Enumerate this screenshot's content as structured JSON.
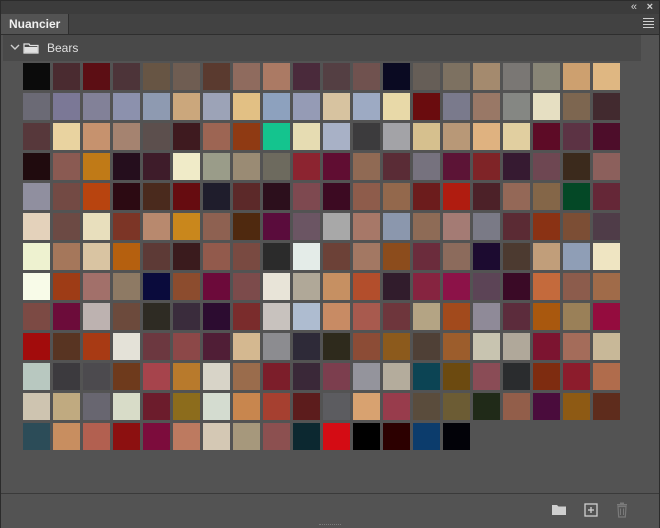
{
  "panel": {
    "tab_label": "Nuancier",
    "collapse_glyph": "«",
    "close_glyph": "×"
  },
  "group": {
    "name": "Bears",
    "icons": {
      "chevron": "chevron-down-icon",
      "folder": "folder-icon"
    }
  },
  "footer": {
    "icons": [
      "new-group-folder-icon",
      "new-swatch-icon",
      "trash-icon"
    ]
  },
  "swatches": [
    "#0b0b0b",
    "#4a2b30",
    "#5c0e14",
    "#4d3439",
    "#675544",
    "#6f5d52",
    "#5a3a2f",
    "#8f6b5e",
    "#ab7a64",
    "#4a2a3b",
    "#543f43",
    "#70524f",
    "#0a0a22",
    "#665e57",
    "#7d7161",
    "#a48a6e",
    "#7a7774",
    "#888576",
    "#cda06f",
    "#dfb782",
    "#6b6a75",
    "#7b7896",
    "#828198",
    "#8c91ad",
    "#8e9ab1",
    "#cba77c",
    "#9ca3b7",
    "#e2c084",
    "#8da1be",
    "#959bb5",
    "#d7c3a0",
    "#9daac3",
    "#e8d9a8",
    "#6a0c0e",
    "#7a7a8c",
    "#997866",
    "#858783",
    "#e6dfc2",
    "#7d6650",
    "#422a2f",
    "#57383b",
    "#e9d3a0",
    "#c6926e",
    "#a58370",
    "#5c4f4d",
    "#3e1a1f",
    "#9d6553",
    "#8f3a13",
    "#14c48e",
    "#e6dcb2",
    "#a8b1c6",
    "#3c3b3d",
    "#a3a3a7",
    "#d6c08e",
    "#b89877",
    "#dfb280",
    "#e1cfa0",
    "#5d0b26",
    "#5c3344",
    "#4d0d2a",
    "#200b0e",
    "#8a5a52",
    "#c07a17",
    "#250e1d",
    "#3e1c2a",
    "#f0ebc8",
    "#9a9c89",
    "#9a8b74",
    "#6d6a5e",
    "#8c2430",
    "#600d32",
    "#906a54",
    "#5a2c36",
    "#76727e",
    "#5c1436",
    "#7f2427",
    "#361a31",
    "#6e4752",
    "#3b2a1c",
    "#8c605c",
    "#908f9f",
    "#734a44",
    "#b8440f",
    "#2c0a12",
    "#4a2a1d",
    "#660c10",
    "#1f1d2c",
    "#5c2929",
    "#2c0f1c",
    "#7e4950",
    "#3c0a22",
    "#8e5c4b",
    "#93684c",
    "#6c1c1c",
    "#b01c10",
    "#4c2128",
    "#946857",
    "#846648",
    "#044826",
    "#652737",
    "#e4d2bb",
    "#6c4a44",
    "#e8dfbd",
    "#7c3526",
    "#b8896e",
    "#c9871c",
    "#8e6151",
    "#4f290f",
    "#5a0c3c",
    "#6b5563",
    "#a8a8a8",
    "#a77868",
    "#8b97ad",
    "#8e6b56",
    "#a47b74",
    "#7a7a86",
    "#5b2b34",
    "#8a3214",
    "#7c4e35",
    "#4f3c48",
    "#eef2d0",
    "#a5775b",
    "#d9c4a2",
    "#b5600f",
    "#5d3a36",
    "#3a1b1d",
    "#925a4c",
    "#794a41",
    "#2b2b2b",
    "#e4ece8",
    "#6c4137",
    "#a37863",
    "#8c4c1c",
    "#6b2c3c",
    "#8c6b5c",
    "#1c0b30",
    "#4c3a30",
    "#c19e7a",
    "#8f9eb6",
    "#efe5c2",
    "#f8fbe8",
    "#9e3c16",
    "#a2706a",
    "#8e7a64",
    "#0a0b3c",
    "#8c4c2e",
    "#6c0a3a",
    "#7c4b4b",
    "#e8e4d8",
    "#b0a898",
    "#c69062",
    "#b34e2c",
    "#311c2c",
    "#862440",
    "#8c1248",
    "#5c4456",
    "#3a0a26",
    "#c46a3c",
    "#8c5c4c",
    "#a06b49",
    "#7c4a44",
    "#6c0c3a",
    "#bdb2b0",
    "#6c4a3c",
    "#2e2b23",
    "#3a2c3c",
    "#2c0c30",
    "#7a2c2c",
    "#c8c2be",
    "#aebcd0",
    "#c88b64",
    "#a85a4e",
    "#6e363c",
    "#b4a484",
    "#a24a1c",
    "#8f8a98",
    "#5c2c3c",
    "#a9580e",
    "#9a8058",
    "#940c3e",
    "#a20c0c",
    "#583422",
    "#a83a14",
    "#e4e2d8",
    "#6c3840",
    "#8c4848",
    "#501e36",
    "#d4b890",
    "#8c8c90",
    "#2e2a38",
    "#2e2a1c",
    "#8c4c36",
    "#8c5a1c",
    "#4f4036",
    "#9c5d2c",
    "#c8c4b0",
    "#b0a89a",
    "#7c1430",
    "#a46c5a",
    "#c8b898",
    "#b8c8c0",
    "#3c3a3e",
    "#4c4a4e",
    "#6e3a1c",
    "#a6444c",
    "#b87a2c",
    "#d8d4c8",
    "#9a6c4c",
    "#7c1e2a",
    "#3a2838",
    "#7c3e4e",
    "#94949c",
    "#b4ac9c",
    "#0c4454",
    "#6c4a10",
    "#8a4c56",
    "#2a2c2e",
    "#7e2c10",
    "#8c1c2c",
    "#b06c4c",
    "#cec4b0",
    "#c0aa80",
    "#686670",
    "#d8dcc8",
    "#6c1c2c",
    "#8c6c1c",
    "#d4dcd0",
    "#c8864e",
    "#a64030",
    "#5c1c1c",
    "#5c5c60",
    "#d8a270",
    "#983c4c",
    "#5a4c3c",
    "#6c5c34",
    "#202a18",
    "#925e4a",
    "#4a0c3c",
    "#8e5a14",
    "#5e2c1c",
    "#2c4c58",
    "#c88e60",
    "#b26050",
    "#8c1010",
    "#7c0c3c",
    "#bd7a60",
    "#d4c8b4",
    "#a6987c",
    "#8c5050",
    "#0c2830",
    "#d40c14",
    "#000000",
    "#2c0000",
    "#0c3c6c",
    "#020208"
  ]
}
